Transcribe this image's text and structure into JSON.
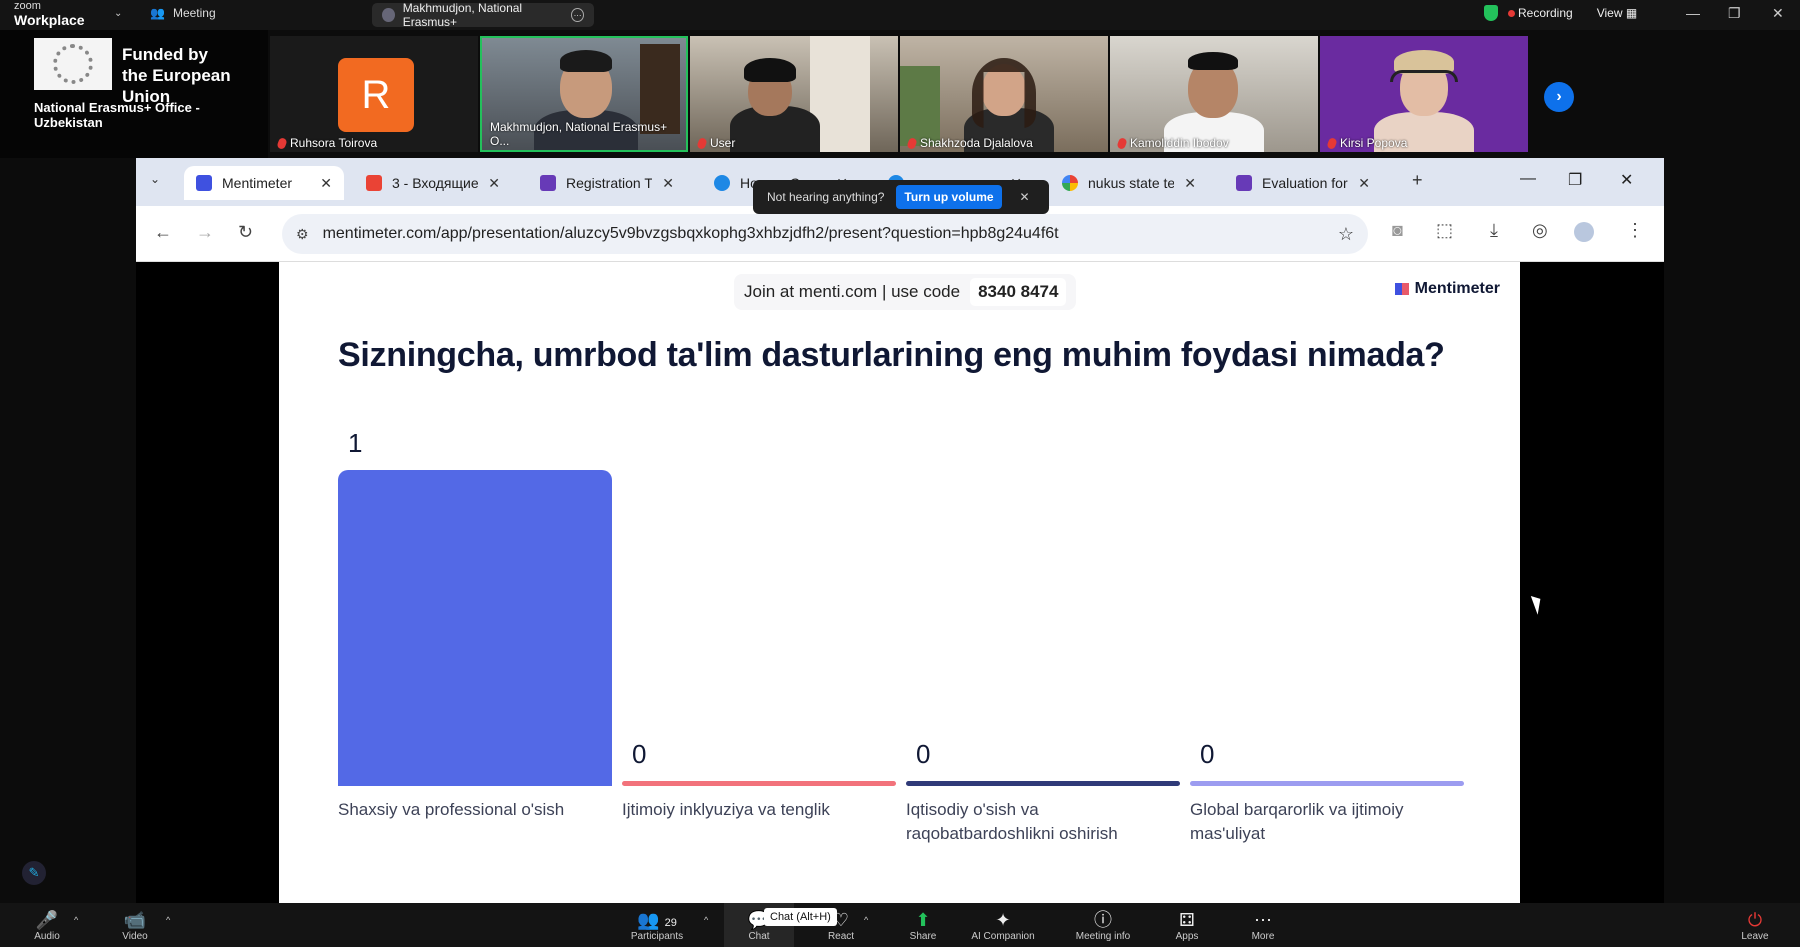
{
  "zoom": {
    "logo_line1": "zoom",
    "logo_line2": "Workplace",
    "meeting_label": "Meeting",
    "active_speaker": "Makhmudjon, National Erasmus+",
    "recording_label": "Recording",
    "view_label": "View"
  },
  "banner": {
    "line1": "Funded by",
    "line2": "the European Union",
    "office": "National Erasmus+ Office - Uzbekistan"
  },
  "participants": [
    {
      "name": "Ruhsora Toirova",
      "initial": "R"
    },
    {
      "name": "Makhmudjon, National Erasmus+ O..."
    },
    {
      "name": "User"
    },
    {
      "name": "Shakhzoda Djalalova"
    },
    {
      "name": "Kamoliddin Ibodov"
    },
    {
      "name": "Kirsi Popova"
    }
  ],
  "browser": {
    "tabs": [
      {
        "label": "Mentimeter",
        "color": "#3f51e0"
      },
      {
        "label": "3 - Входящие",
        "color": "#ea4335"
      },
      {
        "label": "Registration T",
        "color": "#673ab7"
      },
      {
        "label": "Home - Canva",
        "color": "#1e88e5"
      },
      {
        "label": "",
        "color": "#1e88e5"
      },
      {
        "label": "nukus state te",
        "color": "#4285f4"
      },
      {
        "label": "Evaluation for",
        "color": "#673ab7"
      }
    ],
    "url": "mentimeter.com/app/presentation/aluzcy5v9bvzgsbqxkophg3xhbzjdfh2/present?question=hpb8g24u4f6t",
    "toast": {
      "text": "Not hearing anything?",
      "button": "Turn up volume"
    }
  },
  "slide": {
    "join_text": "Join at menti.com | use code",
    "join_code": "8340 8474",
    "brand": "Mentimeter",
    "question": "Sizningcha, umrbod ta'lim dasturlarining eng muhim foydasi nimada?"
  },
  "chart_data": {
    "type": "bar",
    "categories": [
      "Shaxsiy va professional o'sish",
      "Ijtimoiy inklyuziya va tenglik",
      "Iqtisodiy o'sish va raqobatbardoshlikni oshirish",
      "Global barqarorlik va ijtimoiy mas'uliyat"
    ],
    "values": [
      1,
      0,
      0,
      0
    ],
    "colors": [
      "#5369e6",
      "#f2727b",
      "#2f3a78",
      "#9c9cf0"
    ],
    "ylim": [
      0,
      1
    ]
  },
  "toolbar": {
    "items": [
      {
        "label": "Audio",
        "icon": "🎤"
      },
      {
        "label": "Video",
        "icon": "📹"
      },
      {
        "label": "Participants",
        "icon": "👥",
        "count": "29"
      },
      {
        "label": "Chat",
        "icon": "💬"
      },
      {
        "label": "React",
        "icon": "♡"
      },
      {
        "label": "Share",
        "icon": "⬆"
      },
      {
        "label": "AI Companion",
        "icon": "✦"
      },
      {
        "label": "Meeting info",
        "icon": "ⓘ"
      },
      {
        "label": "Apps",
        "icon": "⚃"
      },
      {
        "label": "More",
        "icon": "⋯"
      },
      {
        "label": "Leave",
        "icon": "⏻"
      }
    ],
    "chat_tooltip": "Chat (Alt+H)"
  }
}
